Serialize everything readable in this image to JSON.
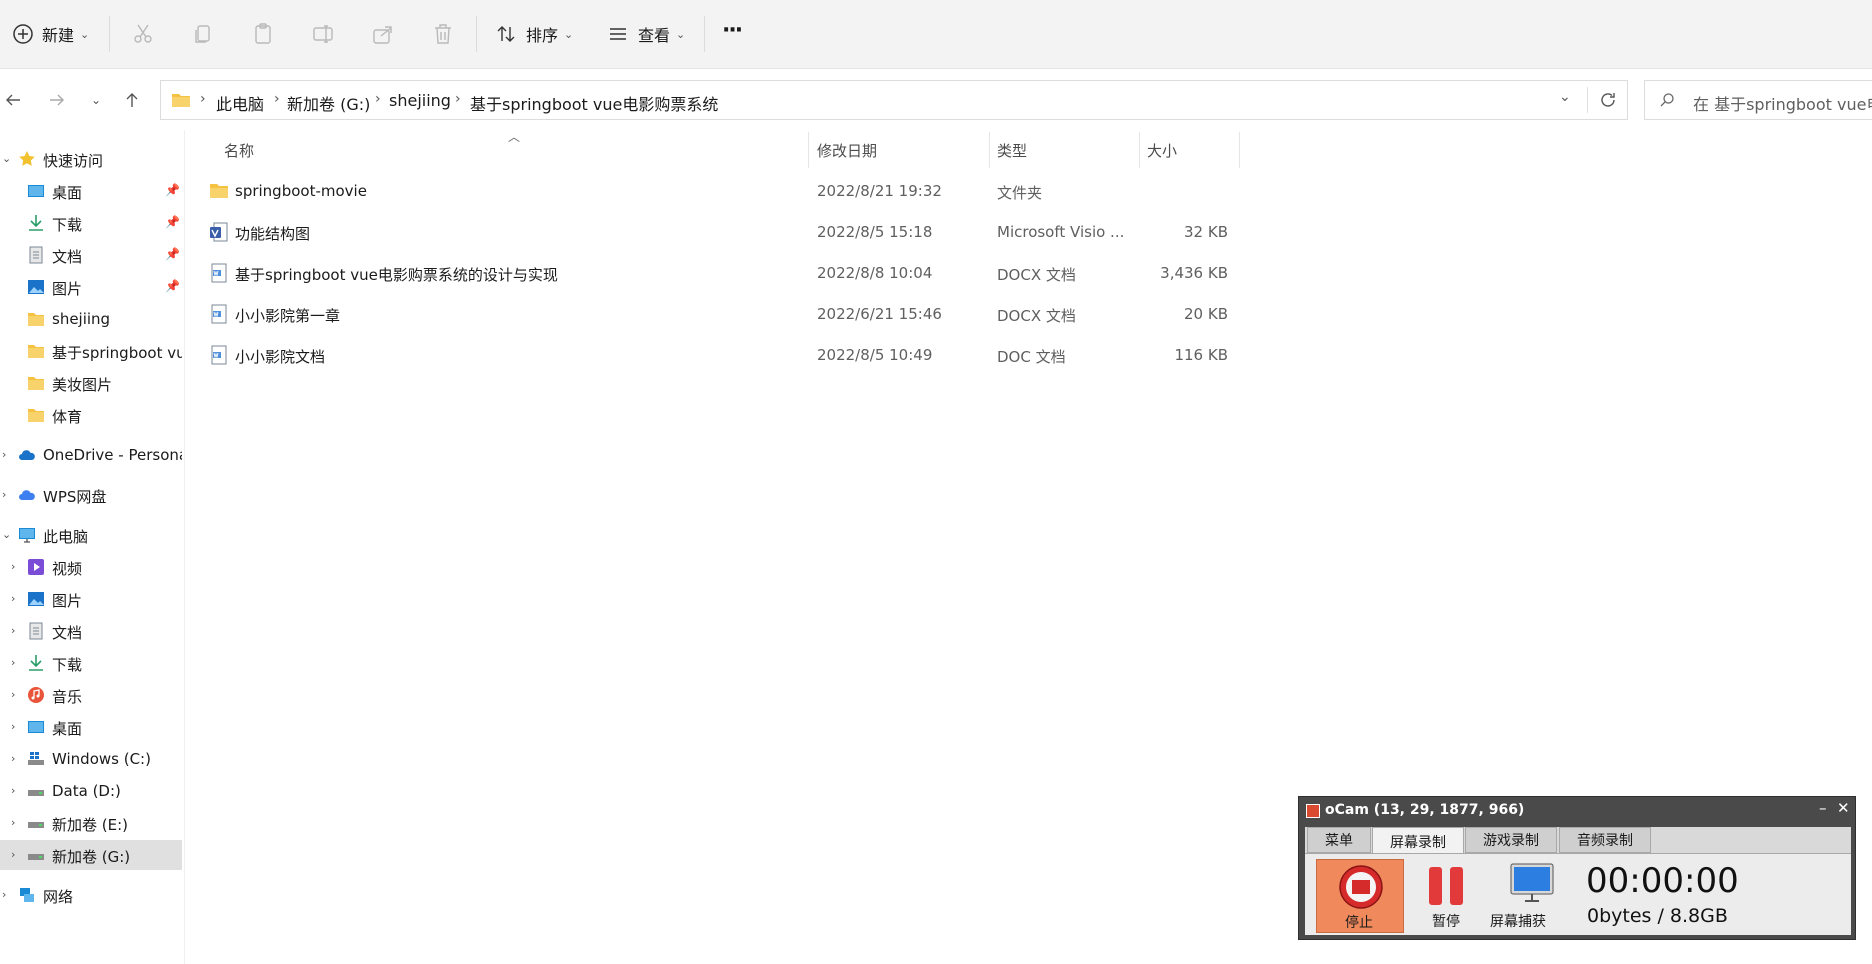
{
  "toolbar": {
    "new_label": "新建",
    "sort_label": "排序",
    "view_label": "查看",
    "more_label": "···"
  },
  "address": {
    "crumbs": [
      "此电脑",
      "新加卷 (G:)",
      "shejiing",
      "基于springboot vue电影购票系统"
    ]
  },
  "search": {
    "placeholder": "在 基于springboot vue电..."
  },
  "nav": {
    "quick_access": "快速访问",
    "quick_items": [
      "桌面",
      "下载",
      "文档",
      "图片",
      "shejiing",
      "基于springboot vue",
      "美妆图片",
      "体育"
    ],
    "onedrive": "OneDrive - Persona",
    "wps": "WPS网盘",
    "this_pc": "此电脑",
    "pc_items": [
      "视频",
      "图片",
      "文档",
      "下载",
      "音乐",
      "桌面",
      "Windows (C:)",
      "Data (D:)",
      "新加卷 (E:)",
      "新加卷 (G:)"
    ],
    "network": "网络"
  },
  "columns": {
    "name": "名称",
    "date": "修改日期",
    "type": "类型",
    "size": "大小"
  },
  "files": [
    {
      "name": "springboot-movie",
      "date": "2022/8/21 19:32",
      "type": "文件夹",
      "size": "",
      "icon": "folder-icon"
    },
    {
      "name": "功能结构图",
      "date": "2022/8/5 15:18",
      "type": "Microsoft Visio ...",
      "size": "32 KB",
      "icon": "visio-file-icon"
    },
    {
      "name": "基于springboot vue电影购票系统的设计与实现",
      "date": "2022/8/8 10:04",
      "type": "DOCX 文档",
      "size": "3,436 KB",
      "icon": "word-file-icon"
    },
    {
      "name": "小小影院第一章",
      "date": "2022/6/21 15:46",
      "type": "DOCX 文档",
      "size": "20 KB",
      "icon": "word-file-icon"
    },
    {
      "name": "小小影院文档",
      "date": "2022/8/5 10:49",
      "type": "DOC 文档",
      "size": "116 KB",
      "icon": "word-file-icon"
    }
  ],
  "ocam": {
    "title": "oCam (13, 29, 1877, 966)",
    "tabs": [
      "菜单",
      "屏幕录制",
      "游戏录制",
      "音频录制"
    ],
    "stop_label": "停止",
    "pause_label": "暂停",
    "capture_label": "屏幕捕获",
    "time": "00:00:00",
    "size": "0bytes / 8.8GB"
  },
  "colors": {
    "folder": "#f5c242",
    "accent": "#1a73c8",
    "ocam_record": "#f08a5c"
  }
}
